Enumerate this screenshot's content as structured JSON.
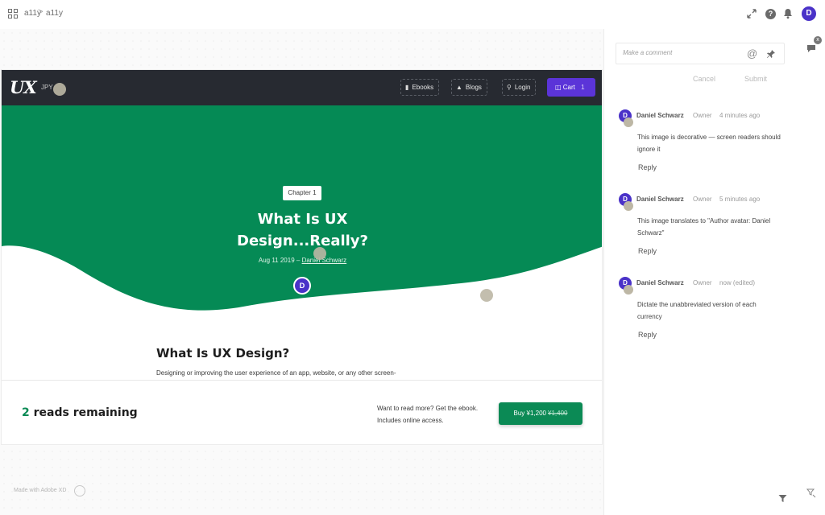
{
  "topbar": {
    "crumbs": [
      "a11y",
      "a11y"
    ],
    "separator": ">",
    "user_initial": "D",
    "help_glyph": "?"
  },
  "site": {
    "logo": "UX",
    "currency": "JPY",
    "nav": [
      {
        "label": "Ebooks",
        "icon": "book-icon"
      },
      {
        "label": "Blogs",
        "icon": "cap-icon"
      },
      {
        "label": "Login",
        "icon": "key-icon"
      }
    ],
    "cart_label": "Cart",
    "cart_count": "1"
  },
  "hero": {
    "chapter": "Chapter 1",
    "title": "What Is UX Design...Really?",
    "date": "Aug 11 2019",
    "dash": "–",
    "author": "Daniel Schwarz",
    "avatar_initial": "D",
    "color": "#058a55"
  },
  "article": {
    "title": "What Is UX Design?",
    "excerpt": "Designing or improving the user experience of an app, website, or any other screen-"
  },
  "paywall": {
    "count": "2",
    "reads_label": "reads remaining",
    "prompt": "Want to read more? Get the ebook. Includes online access.",
    "buy_label": "Buy ¥1,200",
    "old_price": "¥1,400"
  },
  "footer": {
    "made_with": "Made with Adobe XD"
  },
  "comments_panel": {
    "placeholder": "Make a comment",
    "at_glyph": "@",
    "cancel": "Cancel",
    "submit": "Submit",
    "comments": [
      {
        "initial": "D",
        "author": "Daniel Schwarz",
        "role": "Owner",
        "time": "4 minutes ago",
        "text": "This image is decorative — screen readers should ignore it",
        "reply": "Reply"
      },
      {
        "initial": "D",
        "author": "Daniel Schwarz",
        "role": "Owner",
        "time": "5 minutes ago",
        "text": "This image translates to \"Author avatar: Daniel Schwarz\"",
        "reply": "Reply"
      },
      {
        "initial": "D",
        "author": "Daniel Schwarz",
        "role": "Owner",
        "time": "now (edited)",
        "text": "Dictate the unabbreviated version of each currency",
        "reply": "Reply"
      }
    ],
    "badge_count": "x"
  },
  "colors": {
    "accent": "#5b34d8",
    "brand_green": "#0b8a55",
    "nav_dark": "#272a31"
  }
}
